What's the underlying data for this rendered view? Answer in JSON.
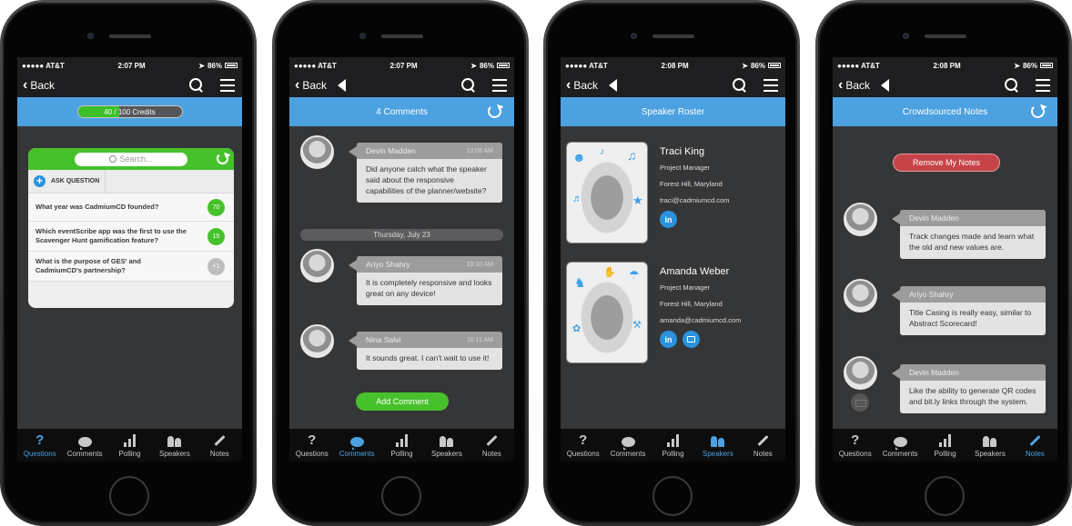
{
  "status_bar_common": {
    "carrier": "●●●●● AT&T",
    "battery": "86%"
  },
  "tabs": [
    {
      "label": "Questions",
      "icon": "question-icon"
    },
    {
      "label": "Comments",
      "icon": "comment-bubble-icon"
    },
    {
      "label": "Polling",
      "icon": "bar-chart-icon"
    },
    {
      "label": "Speakers",
      "icon": "people-icon"
    },
    {
      "label": "Notes",
      "icon": "pencil-icon"
    }
  ],
  "nav": {
    "back_label": "Back"
  },
  "colors": {
    "accent_blue": "#4ca1e0",
    "green": "#46c12b",
    "red": "#c64449",
    "badge_gray": "#bdbdbd"
  },
  "screens": [
    {
      "id": "questions",
      "time": "2:07 PM",
      "active_tab": "Questions",
      "credits": {
        "label": "40 / 100 Credits",
        "used": 40,
        "total": 100
      },
      "search_placeholder": "Search...",
      "ask_question_label": "ASK QUESTION",
      "questions": [
        {
          "text": "What year was CadmiumCD founded?",
          "votes": "70",
          "badge": "green"
        },
        {
          "text": "Which eventScribe app was the first to use the Scavenger Hunt gamification feature?",
          "votes": "15",
          "badge": "green"
        },
        {
          "text": "What is the purpose of GES' and CadmiumCD's partnership?",
          "votes": "+1",
          "badge": "gray"
        }
      ]
    },
    {
      "id": "comments",
      "time": "2:07 PM",
      "active_tab": "Comments",
      "title": "4 Comments",
      "comments": [
        {
          "author": "Devin Madden",
          "time": "10:08 AM",
          "text": "Did anyone catch what the speaker said about the responsive capabilities of the planner/website?"
        },
        {
          "author": "Ariyo Shahry",
          "time": "10:10 AM",
          "text": "It is completely responsive and looks great on any device!"
        },
        {
          "author": "Nina Salvi",
          "time": "10:11 AM",
          "text": "It sounds great. I can't wait to use it!"
        }
      ],
      "date_divider": "Thursday, July 23",
      "add_comment_label": "Add Comment"
    },
    {
      "id": "speakers",
      "time": "2:08 PM",
      "active_tab": "Speakers",
      "title": "Speaker Roster",
      "speakers": [
        {
          "name": "Traci King",
          "title": "Project Manager",
          "location": "Forest Hill, Maryland",
          "email": "traci@cadmiumcd.com",
          "links": [
            "linkedin"
          ]
        },
        {
          "name": "Amanda Weber",
          "title": "Project Manager",
          "location": "Forest Hill, Maryland",
          "email": "amanda@cadmiumcd.com",
          "links": [
            "linkedin",
            "presentation"
          ]
        }
      ]
    },
    {
      "id": "notes",
      "time": "2:08 PM",
      "active_tab": "Notes",
      "title": "Crowdsourced Notes",
      "remove_label": "Remove My Notes",
      "notes": [
        {
          "author": "Devin Madden",
          "text": "Track changes made and learn what the old and new values are."
        },
        {
          "author": "Ariyo Shahry",
          "text": "Title Casing is really easy, similar to Abstract Scorecard!"
        },
        {
          "author": "Devin Madden",
          "text": "Like the ability to generate QR codes and bit.ly links through the system."
        }
      ]
    }
  ]
}
